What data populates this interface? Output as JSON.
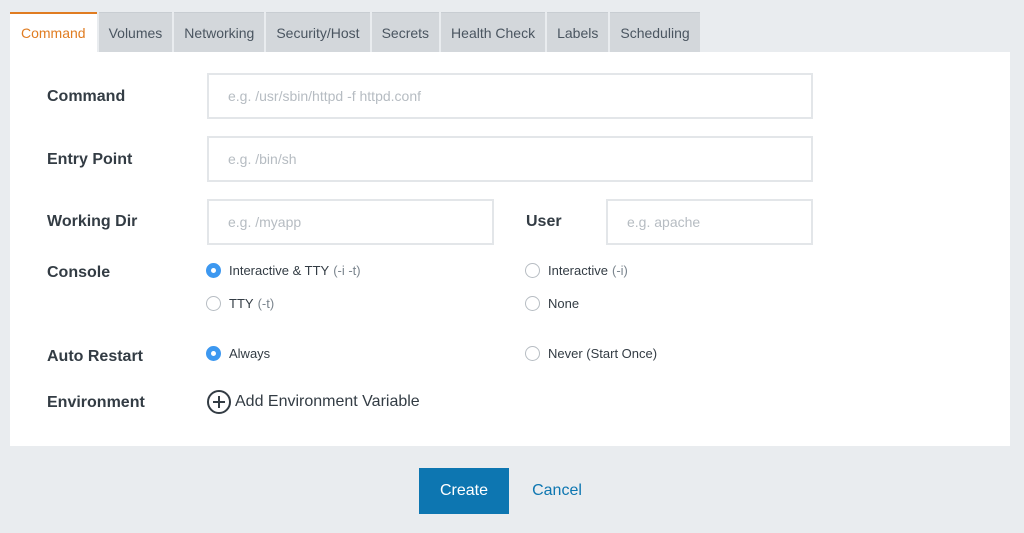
{
  "tabs": [
    {
      "label": "Command"
    },
    {
      "label": "Volumes"
    },
    {
      "label": "Networking"
    },
    {
      "label": "Security/Host"
    },
    {
      "label": "Secrets"
    },
    {
      "label": "Health Check"
    },
    {
      "label": "Labels"
    },
    {
      "label": "Scheduling"
    }
  ],
  "active_tab": "Command",
  "form": {
    "command": {
      "label": "Command",
      "placeholder": "e.g. /usr/sbin/httpd -f httpd.conf",
      "value": ""
    },
    "entry_point": {
      "label": "Entry Point",
      "placeholder": "e.g. /bin/sh",
      "value": ""
    },
    "working_dir": {
      "label": "Working Dir",
      "placeholder": "e.g. /myapp",
      "value": ""
    },
    "user": {
      "label": "User",
      "placeholder": "e.g. apache",
      "value": ""
    },
    "console": {
      "label": "Console",
      "options": [
        {
          "label": "Interactive & TTY",
          "hint": "(-i -t)",
          "selected": true
        },
        {
          "label": "Interactive",
          "hint": "(-i)",
          "selected": false
        },
        {
          "label": "TTY",
          "hint": "(-t)",
          "selected": false
        },
        {
          "label": "None",
          "hint": "",
          "selected": false
        }
      ]
    },
    "auto_restart": {
      "label": "Auto Restart",
      "options": [
        {
          "label": "Always",
          "selected": true
        },
        {
          "label": "Never (Start Once)",
          "selected": false
        }
      ]
    },
    "environment": {
      "label": "Environment",
      "add_label": "Add Environment Variable",
      "icon": "plus-circle-icon"
    }
  },
  "actions": {
    "create_label": "Create",
    "cancel_label": "Cancel"
  },
  "colors": {
    "accent": "#e07c21",
    "primary": "#0d76b1",
    "radio_selected": "#3d98f0"
  }
}
